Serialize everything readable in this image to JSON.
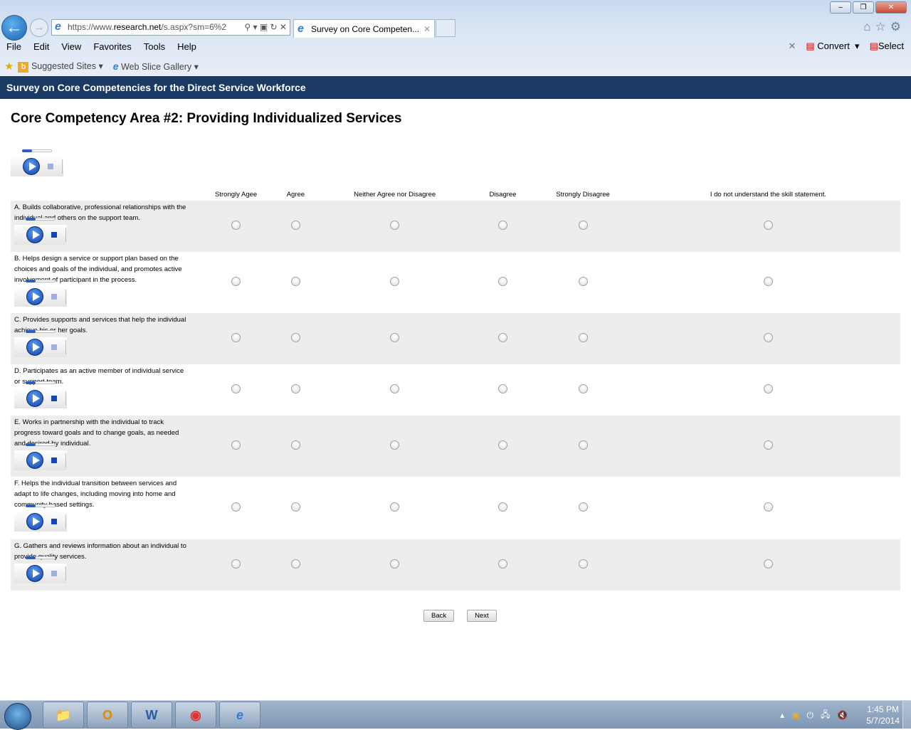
{
  "browser": {
    "url_prefix": "https://www.",
    "url_domain": "research.net",
    "url_path": "/s.aspx?sm=6%2",
    "tab_title": "Survey on Core Competen...",
    "menu": [
      "File",
      "Edit",
      "View",
      "Favorites",
      "Tools",
      "Help"
    ],
    "convert_label": "Convert",
    "select_label": "Select",
    "favorites": [
      "Suggested Sites",
      "Web Slice Gallery"
    ]
  },
  "survey": {
    "header": "Survey on Core Competencies for the Direct Service Workforce",
    "title": "Core Competency Area #2: Providing Individualized Services",
    "columns": [
      "Strongly Agee",
      "Agree",
      "Neither Agree nor Disagree",
      "Disagree",
      "Strongly Disagree",
      "I do not understand the skill statement."
    ],
    "questions": [
      "A. Builds collaborative, professional relationships with the individual and others on the support team.",
      "B. Helps design a service or support plan based on the choices and goals of the individual, and promotes active involvement of participant in the process.",
      "C. Provides supports and services that help the individual achieve his or her goals.",
      "D. Participates as an active member of individual service or support team.",
      "E. Works in partnership with the individual to track progress toward goals and to change goals, as needed and desired by individual.",
      "F. Helps the individual transition between services and adapt to life changes, including moving into home and community based settings.",
      "G. Gathers and reviews information about an individual to provide quality services."
    ],
    "back_label": "Back",
    "next_label": "Next"
  },
  "taskbar": {
    "time": "1:45 PM",
    "date": "5/7/2014"
  }
}
